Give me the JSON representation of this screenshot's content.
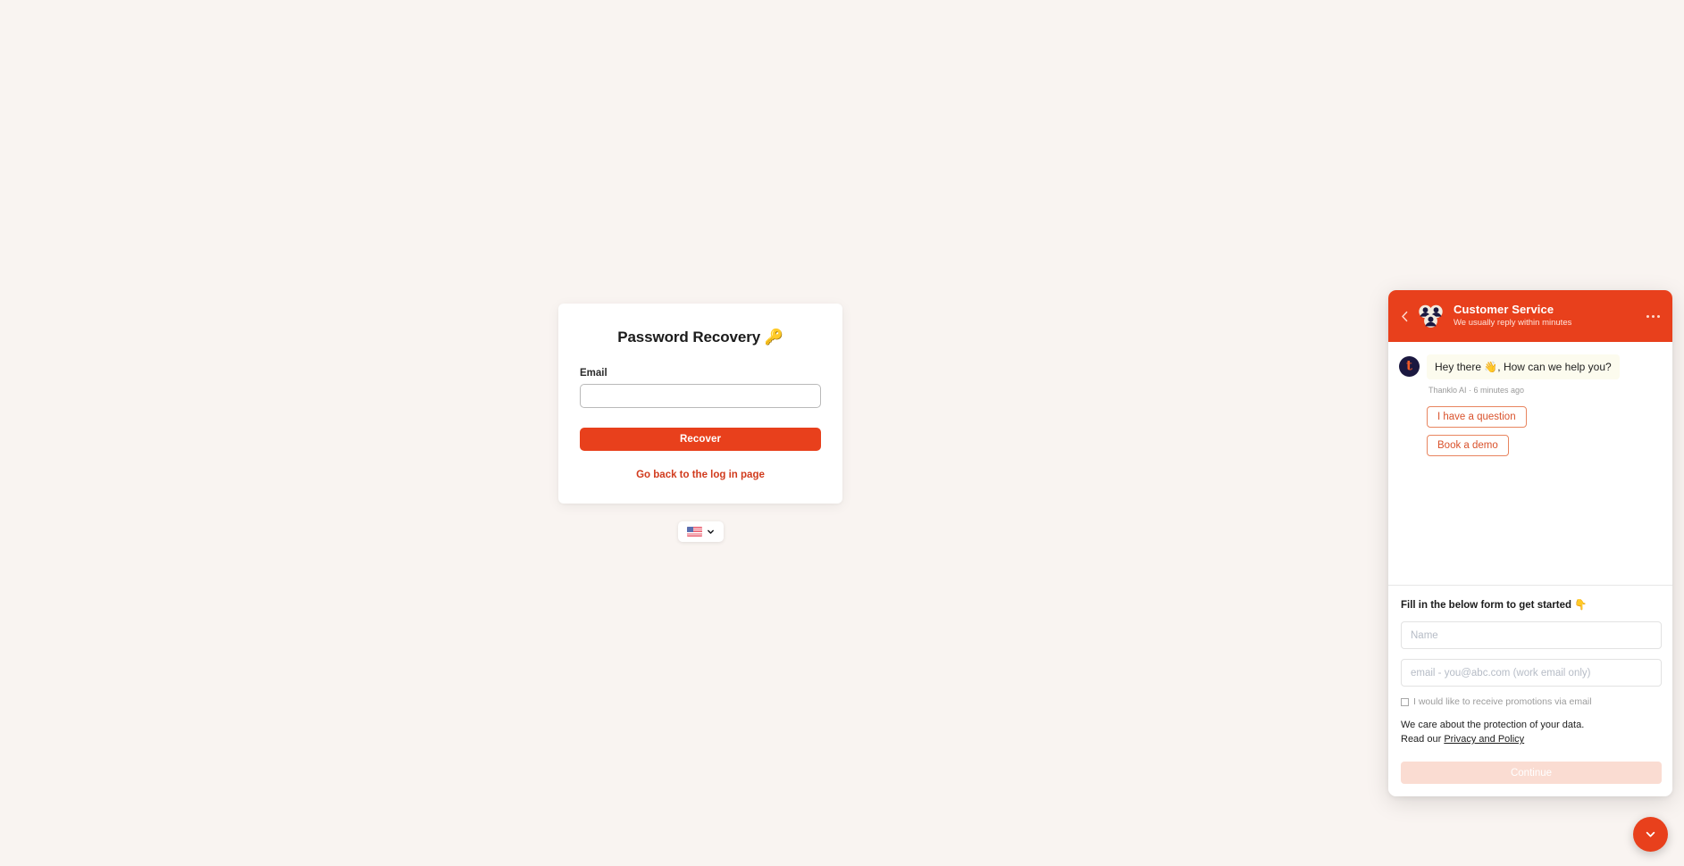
{
  "page": {
    "background_color": "#f9f4f1",
    "accent_color": "#e8401c"
  },
  "recovery": {
    "title": "Password Recovery 🔑",
    "email_label": "Email",
    "email_value": "",
    "email_placeholder": "",
    "recover_button": "Recover",
    "back_link": "Go back to the log in page",
    "language": {
      "flag": "us-flag-icon",
      "chevron": "chevron-down-icon"
    }
  },
  "chat": {
    "header": {
      "back_icon": "chevron-left-icon",
      "avatar_icon": "agents-group-icon",
      "title": "Customer Service",
      "subtitle": "We usually reply within minutes",
      "menu_icon": "ellipsis-icon"
    },
    "message": {
      "avatar_letter": "t",
      "text": "Hey there 👋, How can we help you?",
      "meta": "Thanklo AI · 6 minutes ago"
    },
    "quick_replies": [
      {
        "label": "I have a question"
      },
      {
        "label": "Book a demo"
      }
    ],
    "form": {
      "heading": "Fill in the below form to get started 👇",
      "name_value": "",
      "name_placeholder": "Name",
      "email_value": "",
      "email_placeholder": "email - you@abc.com (work email only)",
      "promo_label": "I would like to receive promotions via email",
      "promo_checked": false,
      "privacy_line1": "We care about the protection of your data.",
      "privacy_line2_prefix": "Read our ",
      "privacy_link": "Privacy and Policy",
      "continue_button": "Continue"
    }
  },
  "launcher": {
    "icon": "chevron-down-icon"
  }
}
